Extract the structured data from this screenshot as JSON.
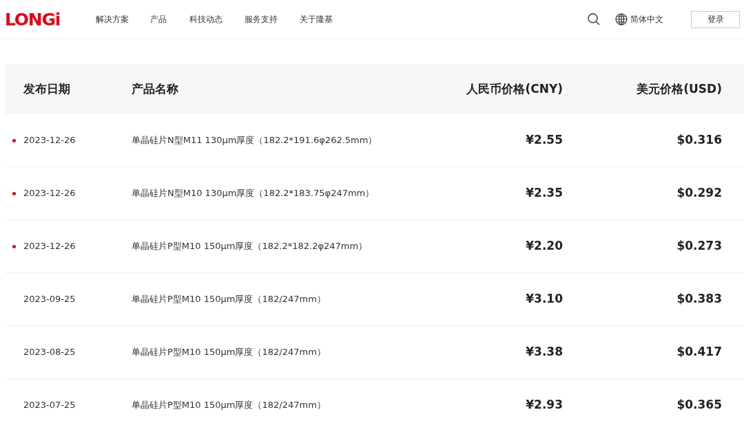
{
  "header": {
    "logo": "LONGi",
    "nav": [
      "解决方案",
      "产品",
      "科技动态",
      "服务支持",
      "关于隆基"
    ],
    "language": "简体中文",
    "login": "登录"
  },
  "table": {
    "columns": [
      "发布日期",
      "产品名称",
      "人民币价格(CNY)",
      "美元价格(USD)"
    ],
    "rows": [
      {
        "new": true,
        "date": "2023-12-26",
        "product": "单晶硅片N型M11 130μm厚度（182.2*191.6φ262.5mm）",
        "cny": "¥2.55",
        "usd": "$0.316"
      },
      {
        "new": true,
        "date": "2023-12-26",
        "product": "单晶硅片N型M10 130μm厚度（182.2*183.75φ247mm）",
        "cny": "¥2.35",
        "usd": "$0.292"
      },
      {
        "new": true,
        "date": "2023-12-26",
        "product": "单晶硅片P型M10 150μm厚度（182.2*182.2φ247mm）",
        "cny": "¥2.20",
        "usd": "$0.273"
      },
      {
        "new": false,
        "date": "2023-09-25",
        "product": "单晶硅片P型M10 150μm厚度（182/247mm）",
        "cny": "¥3.10",
        "usd": "$0.383"
      },
      {
        "new": false,
        "date": "2023-08-25",
        "product": "单晶硅片P型M10 150μm厚度（182/247mm）",
        "cny": "¥3.38",
        "usd": "$0.417"
      },
      {
        "new": false,
        "date": "2023-07-25",
        "product": "单晶硅片P型M10 150μm厚度（182/247mm）",
        "cny": "¥2.93",
        "usd": "$0.365"
      }
    ]
  }
}
